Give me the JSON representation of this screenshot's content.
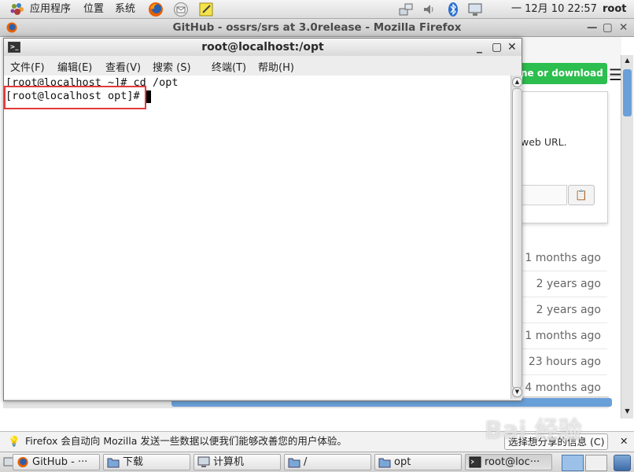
{
  "top_panel": {
    "applications": "应用程序",
    "places": "位置",
    "system": "系统",
    "date": "一 12月 10 22:57",
    "user": "root"
  },
  "firefox": {
    "title": "GitHub - ossrs/srs at 3.0release - Mozilla Firefox",
    "clone_button": "ne or download",
    "clone_popup_text": "web URL.",
    "commit_times": [
      "1 months ago",
      "2 years ago",
      "2 years ago",
      "1 months ago",
      "23 hours ago",
      "4 months ago"
    ],
    "notification": "Firefox 会自动向 Mozilla 发送一些数据以便我们能够改善您的用户体验。",
    "notification_button": "选择想分享的信息 (C)"
  },
  "terminal": {
    "title": "root@localhost:/opt",
    "menu": [
      "文件(F)",
      "编辑(E)",
      "查看(V)",
      "搜索 (S)",
      "终端(T)",
      "帮助(H)"
    ],
    "lines": [
      "[root@localhost ~]# cd /opt",
      "[root@localhost opt]# "
    ]
  },
  "taskbar": {
    "items": [
      "GitHub - ···",
      "下载",
      "计算机",
      "/",
      "opt",
      "root@loc···"
    ]
  },
  "watermark": "Bai 经验"
}
